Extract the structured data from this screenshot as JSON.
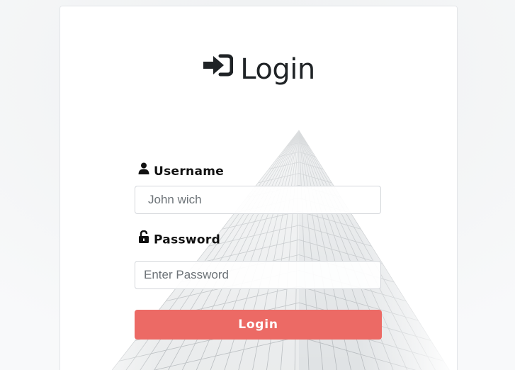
{
  "login_form": {
    "title": "Login",
    "title_icon": "sign-in-icon",
    "username": {
      "label": "Username",
      "icon": "user-icon",
      "placeholder": "John wich",
      "value": ""
    },
    "password": {
      "label": "Password",
      "icon": "unlock-icon",
      "placeholder": "Enter Password",
      "value": ""
    },
    "submit_label": "Login"
  },
  "colors": {
    "button": "#ec6a65",
    "button_text": "#ffffff",
    "title": "#1f2326",
    "card_bg": "#ffffff",
    "page_bg": "#f6f7f8"
  }
}
